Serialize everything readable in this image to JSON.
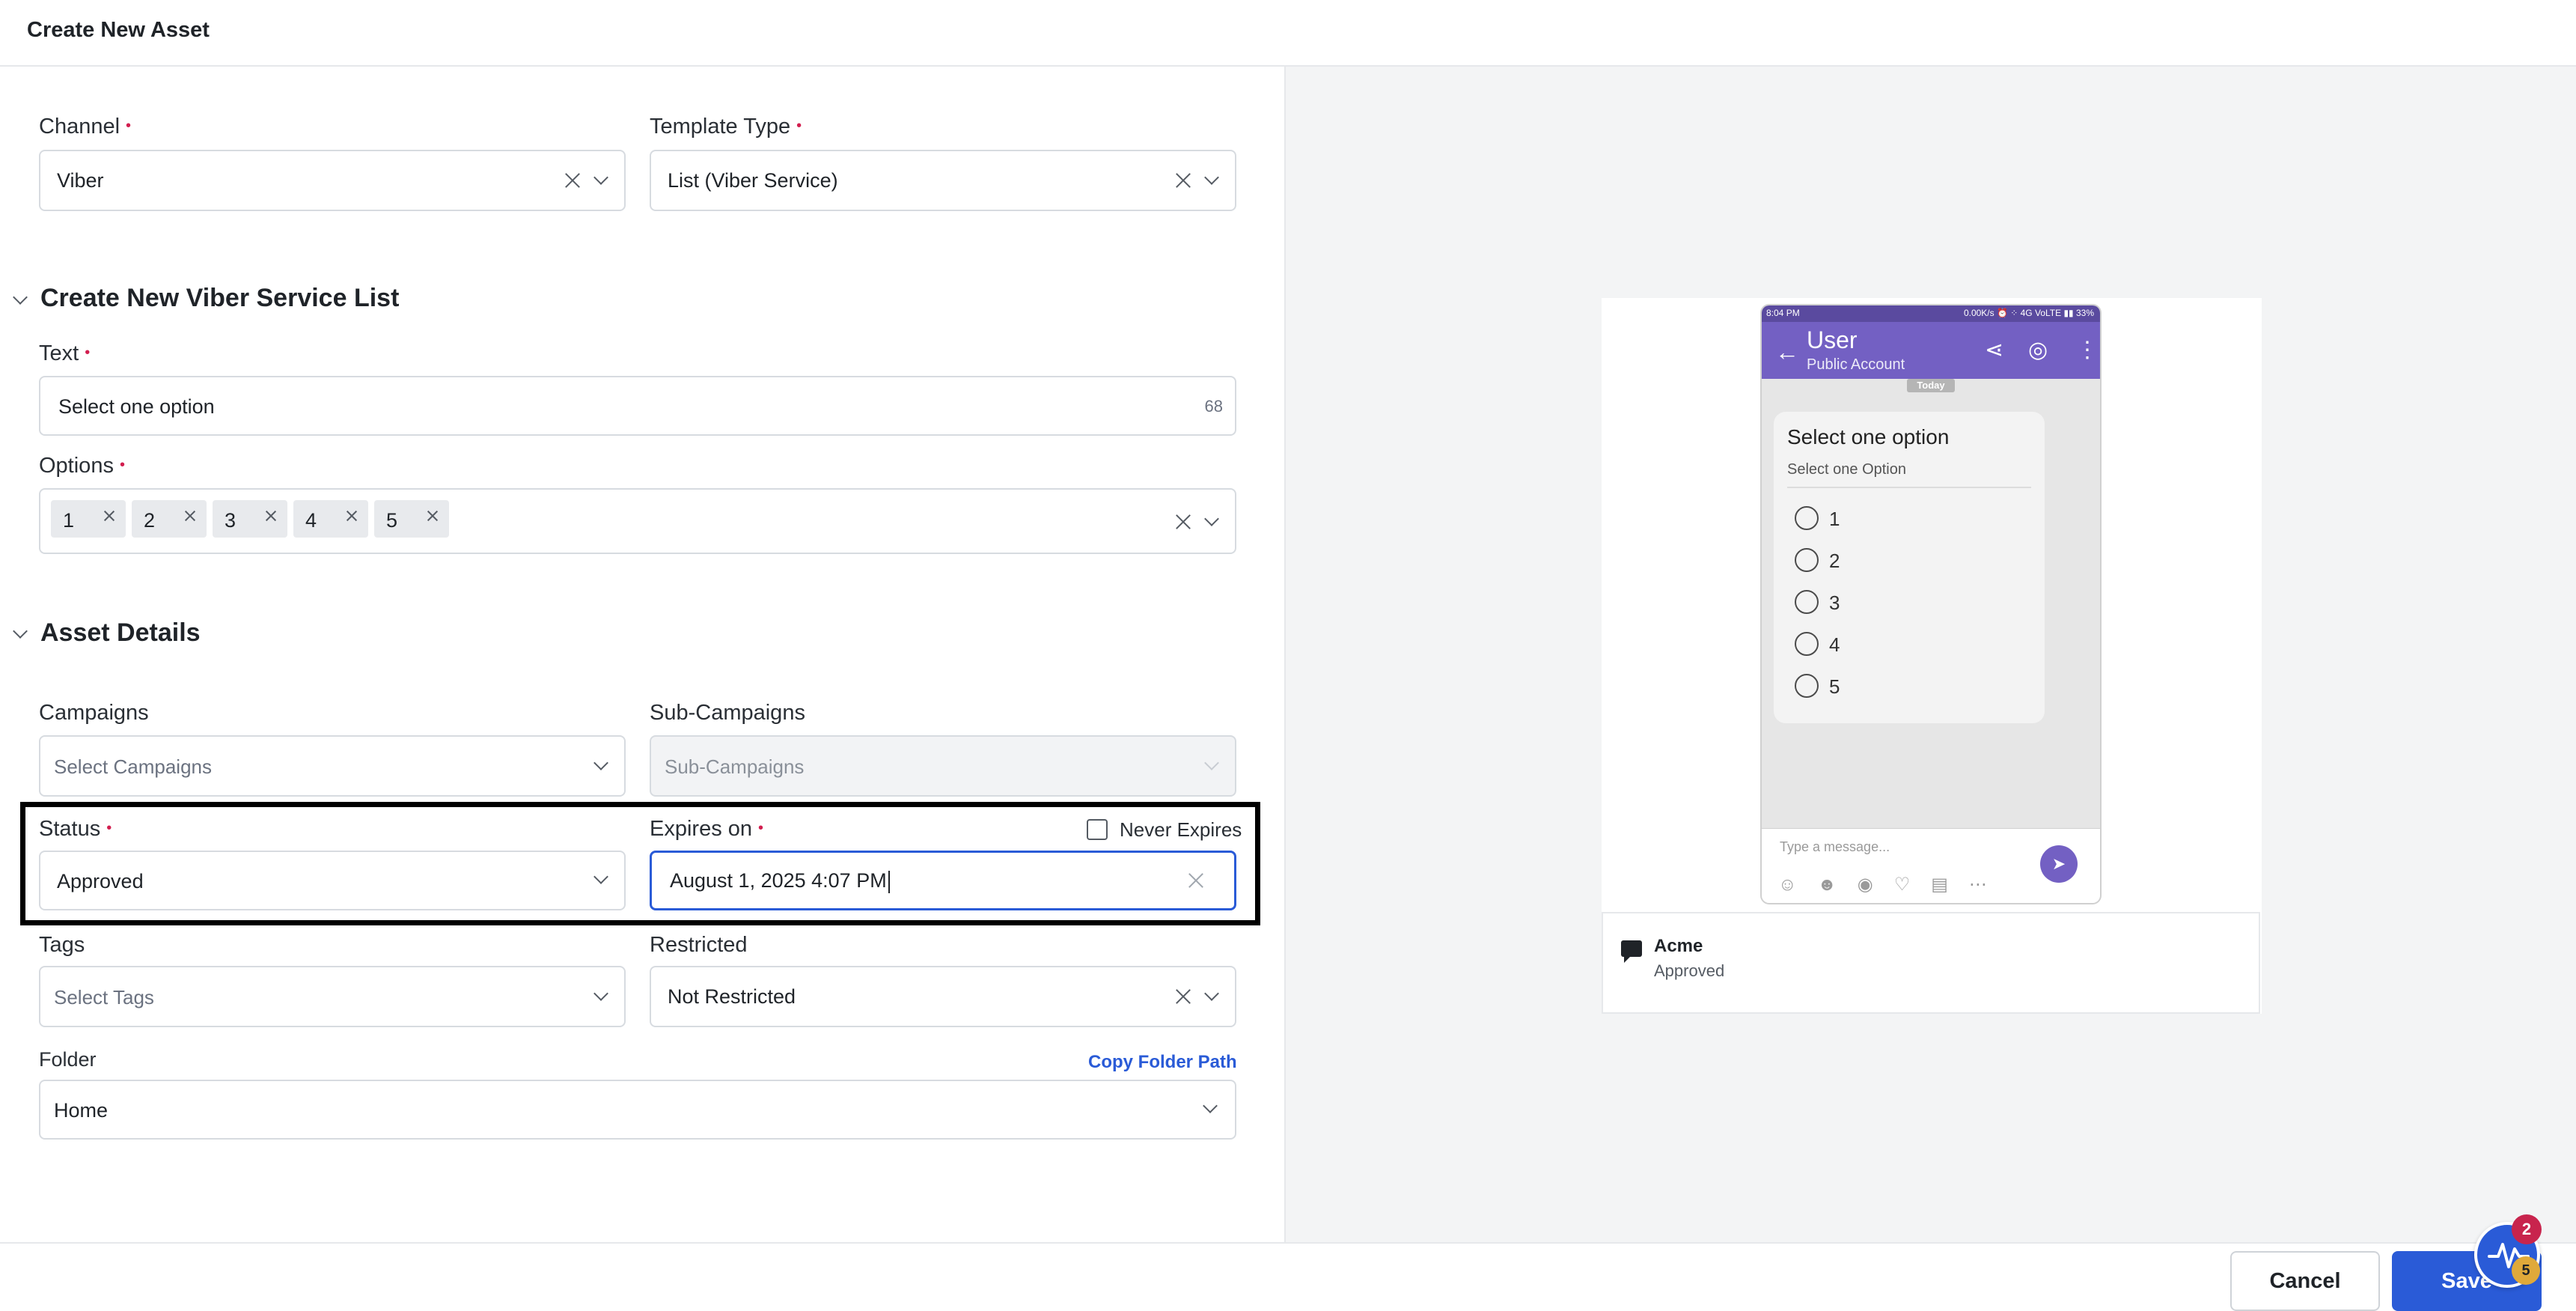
{
  "header": {
    "title": "Create New Asset"
  },
  "channel": {
    "label": "Channel",
    "value": "Viber"
  },
  "template_type": {
    "label": "Template Type",
    "value": "List (Viber Service)"
  },
  "list_section": {
    "title": "Create New Viber Service List",
    "text": {
      "label": "Text",
      "value": "Select one option",
      "counter": "68"
    },
    "options": {
      "label": "Options",
      "tags": [
        "1",
        "2",
        "3",
        "4",
        "5"
      ]
    }
  },
  "asset_details": {
    "title": "Asset Details",
    "campaigns": {
      "label": "Campaigns",
      "placeholder": "Select Campaigns"
    },
    "sub_campaigns": {
      "label": "Sub-Campaigns",
      "placeholder": "Sub-Campaigns"
    },
    "status": {
      "label": "Status",
      "value": "Approved"
    },
    "expires_on": {
      "label": "Expires on",
      "value": "August 1, 2025 4:07 PM",
      "never_expires_label": "Never Expires"
    },
    "tags": {
      "label": "Tags",
      "placeholder": "Select Tags"
    },
    "restricted": {
      "label": "Restricted",
      "value": "Not Restricted"
    },
    "folder": {
      "label": "Folder",
      "value": "Home",
      "copy_path_label": "Copy Folder Path"
    }
  },
  "preview": {
    "status_time": "8:04 PM",
    "status_right": "0.00K/s ⏰ ⁘ 4G VoLTE ▮▮ 33%",
    "user_name": "User",
    "user_subtitle": "Public Account",
    "today_label": "Today",
    "bubble_title": "Select one option",
    "bubble_subtitle": "Select one Option",
    "options": [
      "1",
      "2",
      "3",
      "4",
      "5"
    ],
    "message_placeholder": "Type a message...",
    "asset_name": "Acme",
    "asset_status": "Approved"
  },
  "footer": {
    "cancel_label": "Cancel",
    "save_label": "Save"
  },
  "help_widget": {
    "notifications": "2",
    "count": "5"
  },
  "colors": {
    "accent": "#2a5bd7",
    "required": "#d21e4f",
    "viber_purple": "#7360c3"
  }
}
